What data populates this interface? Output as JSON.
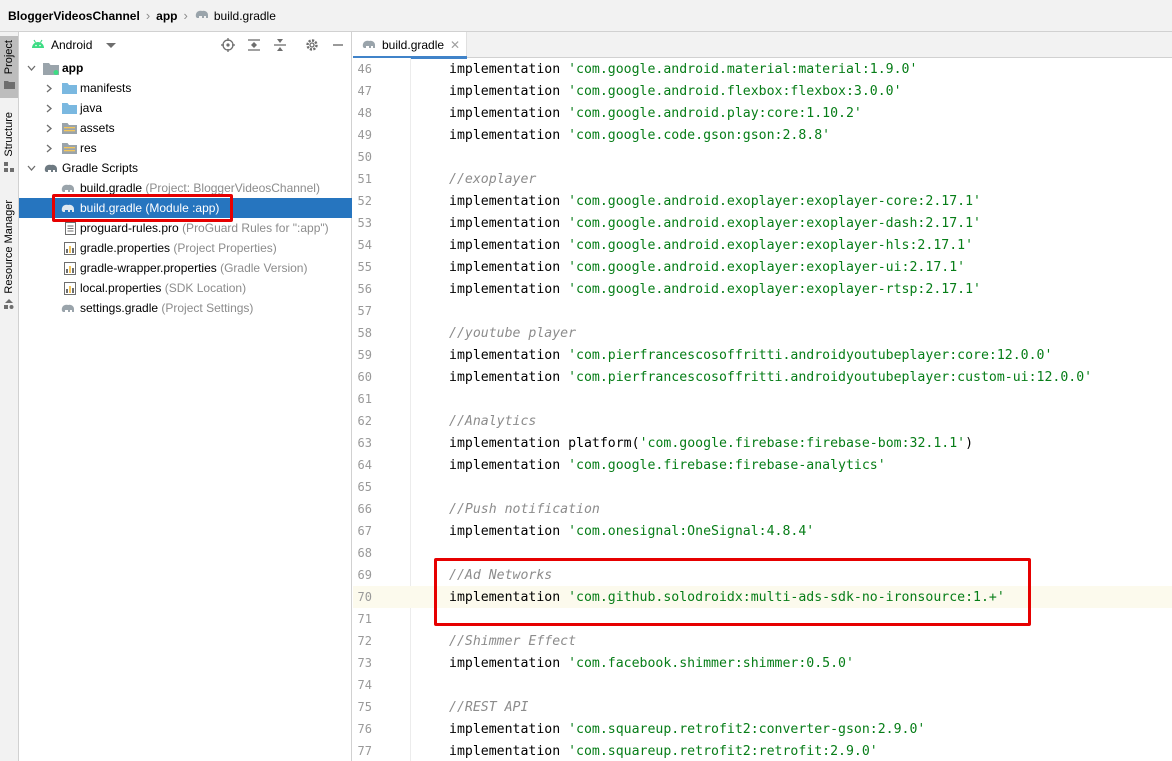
{
  "breadcrumb": {
    "project": "BloggerVideosChannel",
    "module": "app",
    "file": "build.gradle"
  },
  "tool_stripe": {
    "project": "Project",
    "structure": "Structure",
    "resource_manager": "Resource Manager"
  },
  "project_panel": {
    "view": "Android",
    "tree": {
      "app": "app",
      "manifests": "manifests",
      "java": "java",
      "assets": "assets",
      "res": "res",
      "gradle_scripts": "Gradle Scripts",
      "files": [
        {
          "name": "build.gradle",
          "hint": "(Project: BloggerVideosChannel)"
        },
        {
          "name": "build.gradle",
          "hint": "(Module :app)"
        },
        {
          "name": "proguard-rules.pro",
          "hint": "(ProGuard Rules for \":app\")"
        },
        {
          "name": "gradle.properties",
          "hint": "(Project Properties)"
        },
        {
          "name": "gradle-wrapper.properties",
          "hint": "(Gradle Version)"
        },
        {
          "name": "local.properties",
          "hint": "(SDK Location)"
        },
        {
          "name": "settings.gradle",
          "hint": "(Project Settings)"
        }
      ]
    }
  },
  "editor": {
    "tab_label": "build.gradle",
    "caret_line": 70,
    "lines": [
      {
        "n": "46",
        "kw": "implementation ",
        "pre": "",
        "str": "'com.google.android.material:material:1.9.0'",
        "post": "",
        "comment": ""
      },
      {
        "n": "47",
        "kw": "implementation ",
        "pre": "",
        "str": "'com.google.android.flexbox:flexbox:3.0.0'",
        "post": "",
        "comment": ""
      },
      {
        "n": "48",
        "kw": "implementation ",
        "pre": "",
        "str": "'com.google.android.play:core:1.10.2'",
        "post": "",
        "comment": ""
      },
      {
        "n": "49",
        "kw": "implementation ",
        "pre": "",
        "str": "'com.google.code.gson:gson:2.8.8'",
        "post": "",
        "comment": ""
      },
      {
        "n": "50",
        "kw": "",
        "pre": "",
        "str": "",
        "post": "",
        "comment": ""
      },
      {
        "n": "51",
        "kw": "",
        "pre": "",
        "str": "",
        "post": "",
        "comment": "//exoplayer"
      },
      {
        "n": "52",
        "kw": "implementation ",
        "pre": "",
        "str": "'com.google.android.exoplayer:exoplayer-core:2.17.1'",
        "post": "",
        "comment": ""
      },
      {
        "n": "53",
        "kw": "implementation ",
        "pre": "",
        "str": "'com.google.android.exoplayer:exoplayer-dash:2.17.1'",
        "post": "",
        "comment": ""
      },
      {
        "n": "54",
        "kw": "implementation ",
        "pre": "",
        "str": "'com.google.android.exoplayer:exoplayer-hls:2.17.1'",
        "post": "",
        "comment": ""
      },
      {
        "n": "55",
        "kw": "implementation ",
        "pre": "",
        "str": "'com.google.android.exoplayer:exoplayer-ui:2.17.1'",
        "post": "",
        "comment": ""
      },
      {
        "n": "56",
        "kw": "implementation ",
        "pre": "",
        "str": "'com.google.android.exoplayer:exoplayer-rtsp:2.17.1'",
        "post": "",
        "comment": ""
      },
      {
        "n": "57",
        "kw": "",
        "pre": "",
        "str": "",
        "post": "",
        "comment": ""
      },
      {
        "n": "58",
        "kw": "",
        "pre": "",
        "str": "",
        "post": "",
        "comment": "//youtube player"
      },
      {
        "n": "59",
        "kw": "implementation ",
        "pre": "",
        "str": "'com.pierfrancescosoffritti.androidyoutubeplayer:core:12.0.0'",
        "post": "",
        "comment": ""
      },
      {
        "n": "60",
        "kw": "implementation ",
        "pre": "",
        "str": "'com.pierfrancescosoffritti.androidyoutubeplayer:custom-ui:12.0.0'",
        "post": "",
        "comment": ""
      },
      {
        "n": "61",
        "kw": "",
        "pre": "",
        "str": "",
        "post": "",
        "comment": ""
      },
      {
        "n": "62",
        "kw": "",
        "pre": "",
        "str": "",
        "post": "",
        "comment": "//Analytics"
      },
      {
        "n": "63",
        "kw": "implementation ",
        "pre": "platform(",
        "str": "'com.google.firebase:firebase-bom:32.1.1'",
        "post": ")",
        "comment": ""
      },
      {
        "n": "64",
        "kw": "implementation ",
        "pre": "",
        "str": "'com.google.firebase:firebase-analytics'",
        "post": "",
        "comment": ""
      },
      {
        "n": "65",
        "kw": "",
        "pre": "",
        "str": "",
        "post": "",
        "comment": ""
      },
      {
        "n": "66",
        "kw": "",
        "pre": "",
        "str": "",
        "post": "",
        "comment": "//Push notification"
      },
      {
        "n": "67",
        "kw": "implementation ",
        "pre": "",
        "str": "'com.onesignal:OneSignal:4.8.4'",
        "post": "",
        "comment": ""
      },
      {
        "n": "68",
        "kw": "",
        "pre": "",
        "str": "",
        "post": "",
        "comment": ""
      },
      {
        "n": "69",
        "kw": "",
        "pre": "",
        "str": "",
        "post": "",
        "comment": "//Ad Networks"
      },
      {
        "n": "70",
        "kw": "implementation ",
        "pre": "",
        "str": "'com.github.solodroidx:multi-ads-sdk-no-ironsource:1.+'",
        "post": "",
        "comment": ""
      },
      {
        "n": "71",
        "kw": "",
        "pre": "",
        "str": "",
        "post": "",
        "comment": ""
      },
      {
        "n": "72",
        "kw": "",
        "pre": "",
        "str": "",
        "post": "",
        "comment": "//Shimmer Effect"
      },
      {
        "n": "73",
        "kw": "implementation ",
        "pre": "",
        "str": "'com.facebook.shimmer:shimmer:0.5.0'",
        "post": "",
        "comment": ""
      },
      {
        "n": "74",
        "kw": "",
        "pre": "",
        "str": "",
        "post": "",
        "comment": ""
      },
      {
        "n": "75",
        "kw": "",
        "pre": "",
        "str": "",
        "post": "",
        "comment": "//REST API"
      },
      {
        "n": "76",
        "kw": "implementation ",
        "pre": "",
        "str": "'com.squareup.retrofit2:converter-gson:2.9.0'",
        "post": "",
        "comment": ""
      },
      {
        "n": "77",
        "kw": "implementation ",
        "pre": "",
        "str": "'com.squareup.retrofit2:retrofit:2.9.0'",
        "post": "",
        "comment": ""
      }
    ]
  },
  "colors": {
    "selection": "#2675bf",
    "highlight_box": "#e60000",
    "string": "#067d17",
    "comment": "#8c8c8c",
    "caret_row": "#fcfaed",
    "android_green": "#3ddc84"
  },
  "icons": [
    "folder-icon",
    "gradle-elephant-icon",
    "android-icon",
    "locate-icon",
    "expand-all-icon",
    "collapse-all-icon",
    "gear-icon",
    "minimize-icon",
    "chevron-right-icon",
    "chevron-down-icon",
    "close-icon"
  ]
}
